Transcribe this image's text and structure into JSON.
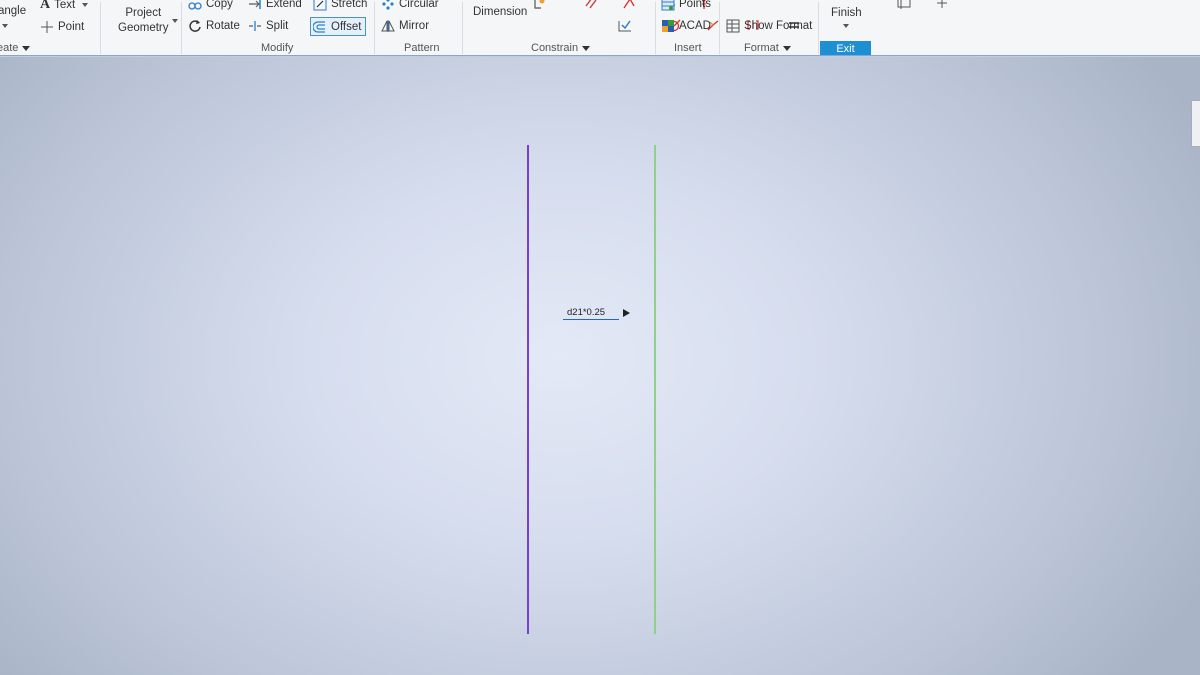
{
  "ribbon": {
    "create": {
      "rectangle_label": "angle",
      "create_label": "eate",
      "text_label": "Text",
      "point_label": "Point"
    },
    "project_geometry": {
      "line1": "Project",
      "line2": "Geometry"
    },
    "modify": {
      "copy": "Copy",
      "extend": "Extend",
      "stretch": "Stretch",
      "rotate": "Rotate",
      "split": "Split",
      "offset": "Offset",
      "group_label": "Modify"
    },
    "pattern": {
      "circular": "Circular",
      "mirror": "Mirror",
      "group_label": "Pattern"
    },
    "constrain": {
      "dimension": "Dimension",
      "group_label": "Constrain"
    },
    "insert": {
      "points": "Points",
      "acad": "ACAD",
      "group_label": "Insert"
    },
    "format": {
      "show_format": "Show Format",
      "group_label": "Format"
    },
    "exit": {
      "finish": "Finish",
      "group_label": "Exit"
    }
  },
  "canvas": {
    "dimension_input": {
      "value": "d21*0.25"
    }
  },
  "colors": {
    "purple_line": "#7a3fd1",
    "green_line": "#8fd08a",
    "accent": "#1e8fd3"
  }
}
